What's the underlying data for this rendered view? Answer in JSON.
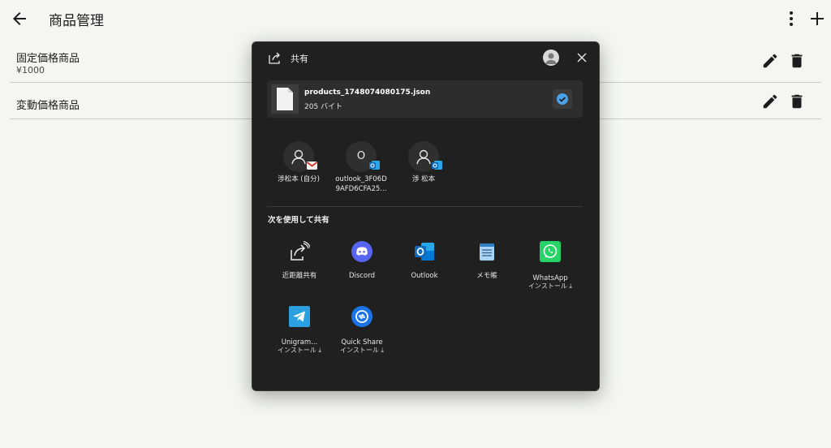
{
  "appbar": {
    "title": "商品管理"
  },
  "products": [
    {
      "name": "固定価格商品",
      "price": "¥1000"
    },
    {
      "name": "変動価格商品",
      "price": ""
    }
  ],
  "share": {
    "title": "共有",
    "file": {
      "name": "products_1748074080175.json",
      "size": "205 バイト"
    },
    "contacts": [
      {
        "label_line1": "渉松本 (自分)",
        "label_line2": "",
        "initial": "",
        "badge": "gmail-icon"
      },
      {
        "label_line1": "outlook_3F06D",
        "label_line2": "9AFD6CFA25...",
        "initial": "O",
        "badge": "outlook-icon"
      },
      {
        "label_line1": "渉 松本",
        "label_line2": "",
        "initial": "",
        "badge": "outlook-icon"
      }
    ],
    "section_label": "次を使用して共有",
    "apps": [
      {
        "label": "近距離共有",
        "sub": "",
        "icon": "nearby-share-icon"
      },
      {
        "label": "Discord",
        "sub": "",
        "icon": "discord-icon"
      },
      {
        "label": "Outlook",
        "sub": "",
        "icon": "outlook-icon"
      },
      {
        "label": "メモ帳",
        "sub": "",
        "icon": "notepad-icon"
      },
      {
        "label": "WhatsApp",
        "sub": "インストール ⤓",
        "icon": "whatsapp-icon"
      },
      {
        "label": "Unigram...",
        "sub": "インストール ⤓",
        "icon": "telegram-icon"
      },
      {
        "label": "Quick Share",
        "sub": "インストール ⤓",
        "icon": "quick-share-icon"
      }
    ]
  },
  "colors": {
    "page_bg": "#f4f7f1",
    "dialog_bg": "#202020",
    "accent_check": "#4aa3e8"
  }
}
